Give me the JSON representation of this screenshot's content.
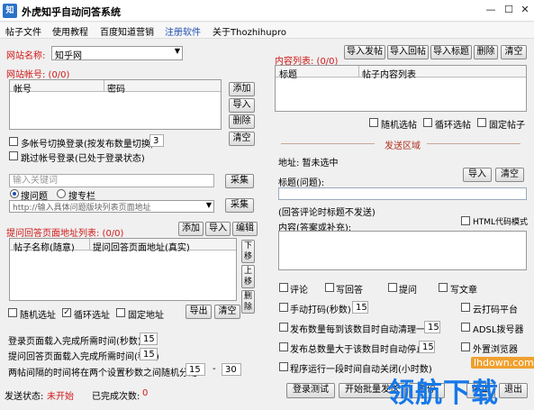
{
  "window": {
    "icon_text": "知",
    "title": "外虎知乎自动问答系统"
  },
  "menu": [
    "帖子文件",
    "使用教程",
    "百度知道营销",
    "注册软件",
    "关于Thozhihupro"
  ],
  "left": {
    "site_name_label": "网站名称:",
    "site_name_value": "知乎网",
    "accounts_label": "网站帐号: (0/0)",
    "accounts_cols": [
      "帐号",
      "密码"
    ],
    "btn_add": "添加",
    "btn_import": "导入",
    "btn_delete": "删除",
    "btn_clear": "清空",
    "multi_switch_label": "多帐号切换登录(按发布数量切换)",
    "multi_switch_value": "3",
    "skip_login_label": "跳过帐号登录(已处于登录状态)",
    "keyword_placeholder": "输入关键词",
    "btn_collect": "采集",
    "radio_question": "搜问题",
    "radio_column": "搜专栏",
    "url_placeholder": "http://输入具体问题版块列表页面地址",
    "btn_collect2": "采集",
    "qurl_label": "提问回答页面地址列表: (0/0)",
    "btn_add2": "添加",
    "btn_import2": "导入",
    "btn_edit": "编辑",
    "qurl_cols": [
      "帖子名称(随意)",
      "提问回答页面地址(真实)"
    ],
    "btn_down": "下移",
    "btn_up": "上移",
    "btn_del": "删除",
    "random_url": "随机选址",
    "cycle_url": "循环选址",
    "fixed_url": "固定地址",
    "btn_export": "导出",
    "btn_clear2": "清空",
    "login_wait_label": "登录页面载入完成所需时间(秒数)",
    "login_wait_value": "15",
    "answer_wait_label": "提问回答页面载入完成所需时间(秒数)",
    "answer_wait_value": "15",
    "interval_label": "两帖间隔的时间将在两个设置秒数之间随机分配",
    "interval_min": "15",
    "interval_dash": "-",
    "interval_max": "30",
    "send_status_label": "发送状态:",
    "send_status_value": "未开始",
    "done_label": "已完成次数:",
    "done_value": "0"
  },
  "right": {
    "btn_import_post": "导入发帖",
    "btn_import_reply": "导入回帖",
    "btn_import_title": "导入标题",
    "btn_delete": "删除",
    "btn_clear": "清空",
    "content_label": "内容列表: (0/0)",
    "content_cols": [
      "标题",
      "帖子内容列表"
    ],
    "random_post": "随机选帖",
    "cycle_post": "循环选帖",
    "fixed_post": "固定帖子",
    "send_area": "发送区域",
    "addr_label": "地址: 暂未选中",
    "btn_import": "导入",
    "btn_clear2": "清空",
    "title_label": "标题(问题):",
    "title_hint": "(回答评论时标题不发送)",
    "content_label2": "内容(答案或补充):",
    "html_mode": "HTML代码模式",
    "opt_comment": "评论",
    "opt_write_answer": "写回答",
    "opt_ask": "提问",
    "opt_write_article": "写文章",
    "manual_code": "手动打码(秒数)",
    "manual_code_value": "15",
    "cloud_code": "云打码平台",
    "clear_count_label": "发布数量每到该数目时自动清理一次",
    "clear_count_value": "15",
    "adsl": "ADSL拨号器",
    "stop_count_label": "发布总数量大于该数目时自动停止",
    "stop_count_value": "15",
    "ext_browser": "外置浏览器",
    "run_time_label": "程序运行一段时间自动关闭(小时数)",
    "btn_login_test": "登录测试",
    "btn_batch_send": "开始批量发送",
    "btn_pause": "暂停",
    "btn_stop": "停止",
    "btn_exit": "退出"
  },
  "watermark": {
    "main": "领航下载",
    "url": "lhdown.com"
  }
}
